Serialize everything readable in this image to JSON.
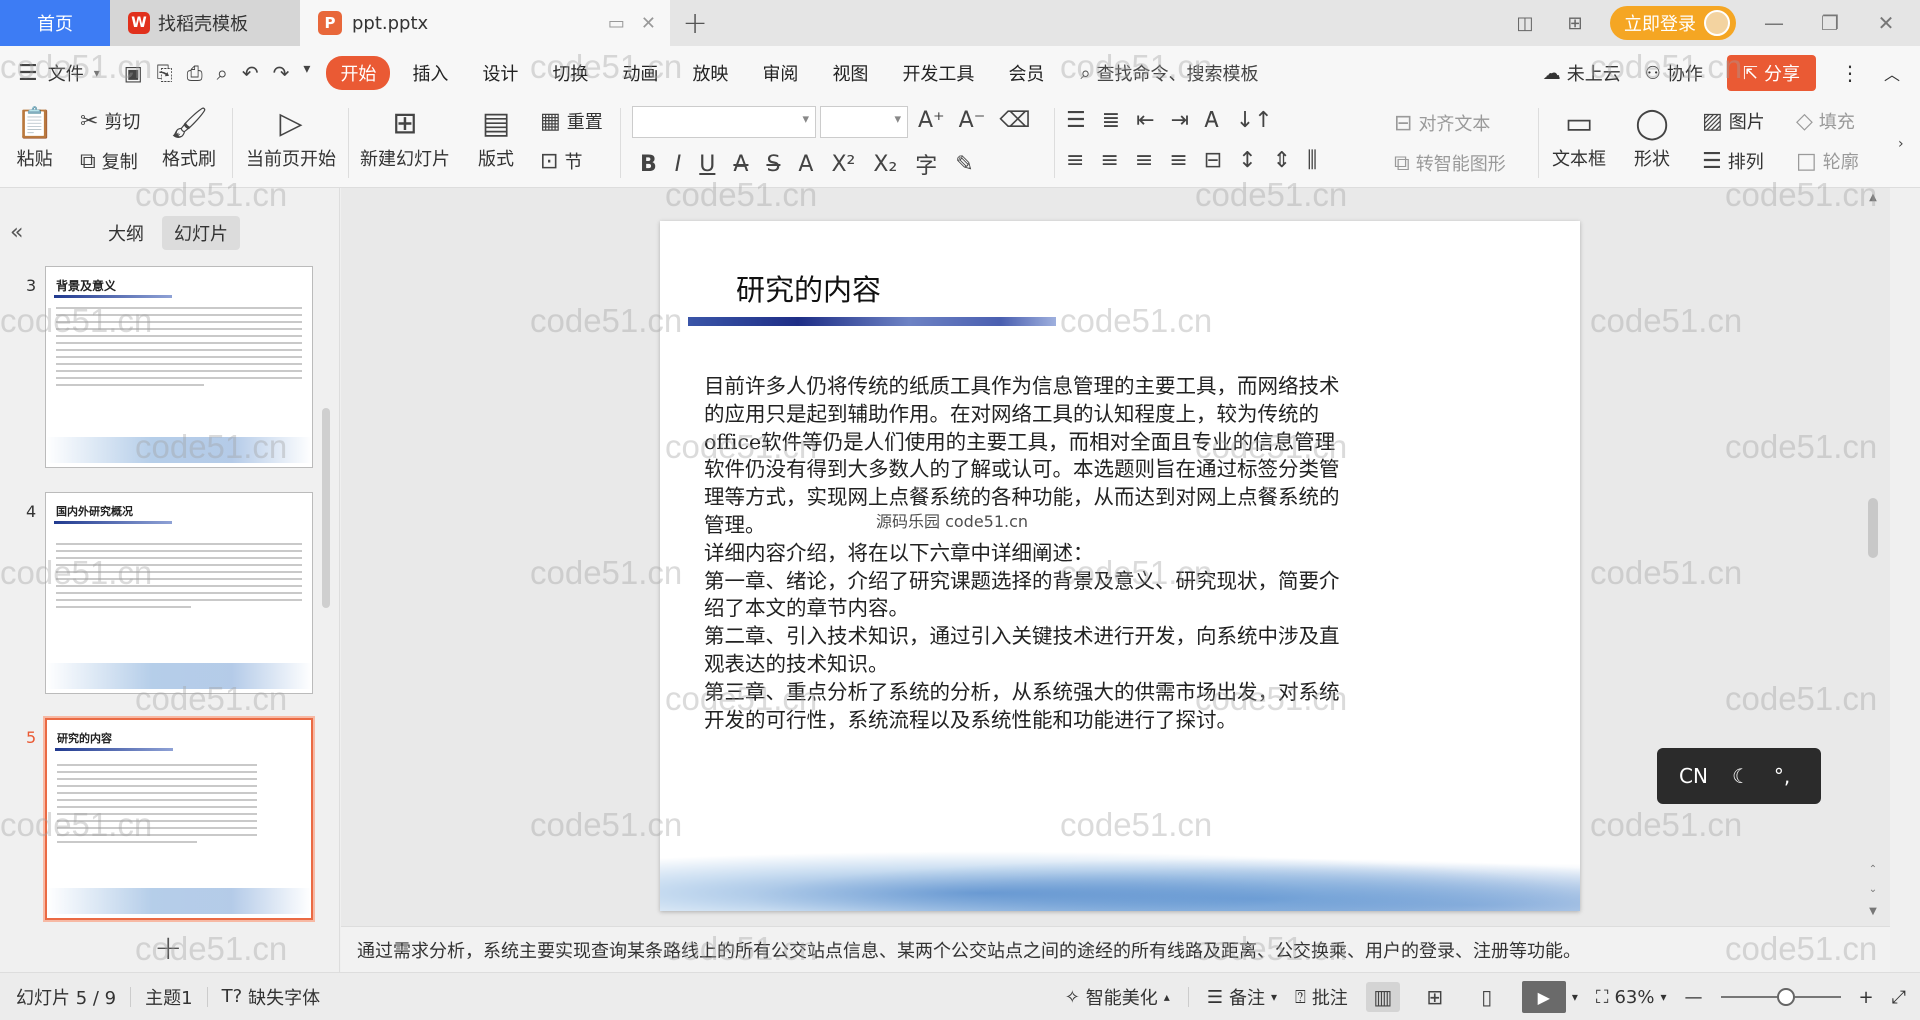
{
  "titlebar": {
    "home_tab": "首页",
    "template_tab": "找稻壳模板",
    "template_logo": "W",
    "file_tab": "ppt.pptx",
    "file_logo": "P",
    "login_label": "立即登录"
  },
  "menubar": {
    "file_label": "文件",
    "tabs": [
      "开始",
      "插入",
      "设计",
      "切换",
      "动画",
      "放映",
      "审阅",
      "视图",
      "开发工具",
      "会员"
    ],
    "search_label": "查找命令、搜索模板",
    "cloud_label": "未上云",
    "collab_label": "协作",
    "share_label": "分享"
  },
  "ribbon": {
    "paste": "粘贴",
    "cut": "剪切",
    "copy": "复制",
    "format_painter": "格式刷",
    "play_current": "当前页开始",
    "new_slide": "新建幻灯片",
    "layout": "版式",
    "reset": "重置",
    "section": "节",
    "align_text": "对齐文本",
    "smart_shape": "转智能图形",
    "textbox": "文本框",
    "shape": "形状",
    "picture": "图片",
    "arrange": "排列",
    "fill": "填充",
    "outline": "轮廓"
  },
  "left_panel": {
    "outline_tab": "大纲",
    "slides_tab": "幻灯片",
    "thumbnails": [
      {
        "num": "3",
        "title": "背景及意义",
        "active": false
      },
      {
        "num": "4",
        "title": "国内外研究概况",
        "active": false
      },
      {
        "num": "5",
        "title": "研究的内容",
        "active": true
      }
    ]
  },
  "slide": {
    "title": "研究的内容",
    "body": "目前许多人仍将传统的纸质工具作为信息管理的主要工具，而网络技术的应用只是起到辅助作用。在对网络工具的认知程度上，较为传统的office软件等仍是人们使用的主要工具，而相对全面且专业的信息管理软件仍没有得到大多数人的了解或认可。本选题则旨在通过标签分类管理等方式，实现网上点餐系统的各种功能，从而达到对网上点餐系统的管理。\n详细内容介绍，将在以下六章中详细阐述：\n第一章、绪论，介绍了研究课题选择的背景及意义、研究现状，简要介绍了本文的章节内容。\n第二章、引入技术知识，通过引入关键技术进行开发，向系统中涉及直观表达的技术知识。\n第三章、重点分析了系统的分析，从系统强大的供需市场出发，对系统开发的可行性，系统流程以及系统性能和功能进行了探讨。",
    "overlay_text": "源码乐园 code51.cn"
  },
  "ime": {
    "lang": "CN",
    "punct": "°,"
  },
  "notes": {
    "text": "通过需求分析，系统主要实现查询某条路线上的所有公交站点信息、某两个公交站点之间的途经的所有线路及距离、公交换乘、用户的登录、注册等功能。"
  },
  "statusbar": {
    "slide_counter": "幻灯片 5 / 9",
    "theme": "主题1",
    "missing_font": "缺失字体",
    "smart_beautify": "智能美化",
    "notes_label": "备注",
    "comment_label": "批注",
    "zoom": "63%"
  },
  "watermark": "code51.cn",
  "colors": {
    "accent": "#ea5a34",
    "home_tab": "#3d7cf4",
    "login": "#f5a623"
  }
}
